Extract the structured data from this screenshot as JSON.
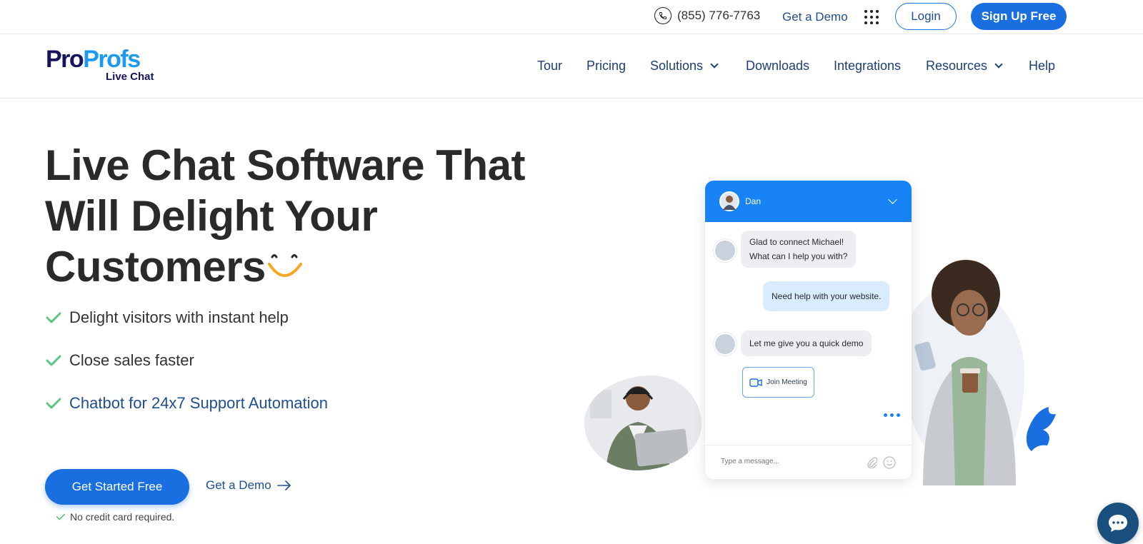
{
  "topbar": {
    "phone": "(855) 776-7763",
    "demo_label": "Get a Demo",
    "login_label": "Login",
    "signup_label": "Sign Up Free"
  },
  "logo": {
    "part1": "Pro",
    "part2": "Profs",
    "sub": "Live Chat"
  },
  "nav": {
    "items": [
      {
        "label": "Tour",
        "has_menu": false
      },
      {
        "label": "Pricing",
        "has_menu": false
      },
      {
        "label": "Solutions",
        "has_menu": true
      },
      {
        "label": "Downloads",
        "has_menu": false
      },
      {
        "label": "Integrations",
        "has_menu": false
      },
      {
        "label": "Resources",
        "has_menu": true
      },
      {
        "label": "Help",
        "has_menu": false
      }
    ]
  },
  "hero": {
    "title_line1": "Live Chat Software That",
    "title_line2": "Will Delight Your",
    "title_line3": "Customers",
    "bullets": [
      {
        "text": "Delight visitors with instant help"
      },
      {
        "text": "Close sales faster"
      },
      {
        "text": "Chatbot for 24x7 Support Automation"
      }
    ],
    "cta_label": "Get Started Free",
    "demo_label": "Get a Demo",
    "note": "No credit card required."
  },
  "chat": {
    "agent_name": "Dan",
    "messages": [
      {
        "from": "agent",
        "line1": "Glad to connect Michael!",
        "line2": "What can I help you with?"
      },
      {
        "from": "user",
        "text": "Need help with your website."
      },
      {
        "from": "agent",
        "text": "Let me give you a quick demo"
      }
    ],
    "meeting_label": "Join Meeting",
    "input_placeholder": "Type a message..."
  },
  "colors": {
    "primary": "#1a6fe0",
    "chat_header": "#1883f6",
    "logo_dark": "#15145c",
    "logo_light": "#1a9bf0",
    "check_green": "#5cc683",
    "smiley_orange": "#f5a623",
    "nav_text": "#1f3f73"
  }
}
